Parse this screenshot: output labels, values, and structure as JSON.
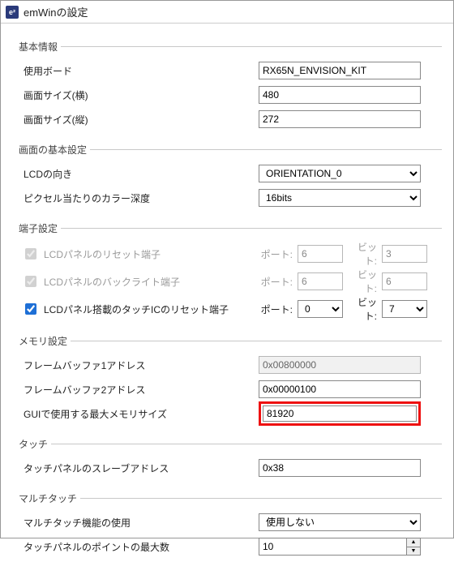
{
  "window": {
    "title": "emWinの設定",
    "icon_label": "e²"
  },
  "groups": {
    "basic_info": {
      "legend": "基本情報",
      "board_label": "使用ボード",
      "board_value": "RX65N_ENVISION_KIT",
      "width_label": "画面サイズ(横)",
      "width_value": "480",
      "height_label": "画面サイズ(縦)",
      "height_value": "272"
    },
    "screen": {
      "legend": "画面の基本設定",
      "orientation_label": "LCDの向き",
      "orientation_value": "ORIENTATION_0",
      "colordepth_label": "ピクセル当たりのカラー深度",
      "colordepth_value": "16bits"
    },
    "pins": {
      "legend": "端子設定",
      "port_label": "ポート:",
      "bit_label": "ビット:",
      "reset_label": "LCDパネルのリセット端子",
      "reset_port": "6",
      "reset_bit": "3",
      "backlight_label": "LCDパネルのバックライト端子",
      "backlight_port": "6",
      "backlight_bit": "6",
      "touchic_label": "LCDパネル搭載のタッチICのリセット端子",
      "touchic_port": "0",
      "touchic_bit": "7"
    },
    "memory": {
      "legend": "メモリ設定",
      "fb1_label": "フレームバッファ1アドレス",
      "fb1_value": "0x00800000",
      "fb2_label": "フレームバッファ2アドレス",
      "fb2_value": "0x00000100",
      "guimem_label": "GUIで使用する最大メモリサイズ",
      "guimem_value": "81920"
    },
    "touch": {
      "legend": "タッチ",
      "slave_label": "タッチパネルのスレーブアドレス",
      "slave_value": "0x38"
    },
    "multitouch": {
      "legend": "マルチタッチ",
      "use_label": "マルチタッチ機能の使用",
      "use_value": "使用しない",
      "maxpoints_label": "タッチパネルのポイントの最大数",
      "maxpoints_value": "10"
    }
  }
}
